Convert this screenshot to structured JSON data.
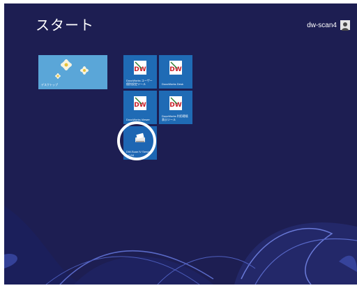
{
  "header": {
    "title": "スタート",
    "user_name": "dw-scan4"
  },
  "tiles": [
    {
      "label": "デスクトップ"
    },
    {
      "label": "DocuWorks ユーザー個別設定ツール"
    },
    {
      "label": "DocuWorks Desk"
    },
    {
      "label": "DocuWorks Viewer"
    },
    {
      "label": "DocuWorks 利用環境表示ツール"
    },
    {
      "label": "DW-Scan IV Service 1.0.04"
    }
  ],
  "colors": {
    "background": "#1d1e52",
    "tile": "#1f6bb5",
    "desktop_tile": "#4f9bd0",
    "highlight_ring": "#ffffff"
  }
}
